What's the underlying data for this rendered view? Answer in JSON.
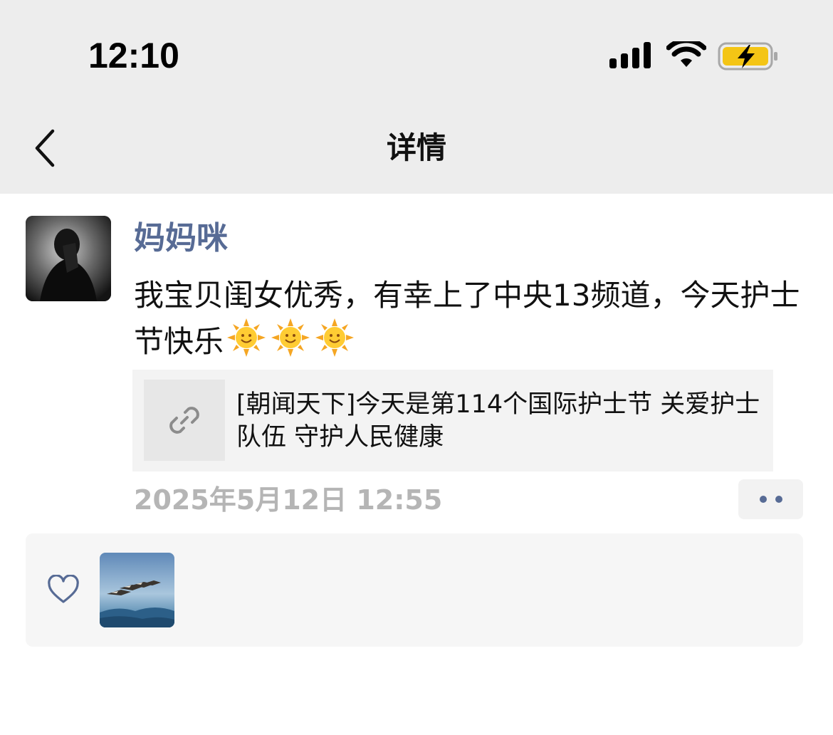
{
  "status_bar": {
    "time": "12:10",
    "icons": [
      "signal-icon",
      "wifi-icon",
      "battery-charging-icon"
    ],
    "battery_color": "#f4c515"
  },
  "nav": {
    "title": "详情",
    "back_icon": "chevron-left-icon"
  },
  "post": {
    "author": "妈妈咪",
    "text": "我宝贝闺女优秀，有幸上了中央13频道，今天护士节快乐",
    "emoji": [
      "sun-with-face",
      "sun-with-face",
      "sun-with-face"
    ],
    "link": {
      "icon": "link-icon",
      "title": "[朝闻天下]今天是第114个国际护士节 关爱护士队伍 守护人民健康"
    },
    "timestamp": "2025年5月12日 12:55",
    "more_icon": "more-dots-icon"
  },
  "likes": {
    "icon": "heart-outline-icon",
    "liker_count": 1
  },
  "colors": {
    "link_blue": "#576b95",
    "header_bg": "#ededed",
    "timestamp_grey": "#b5b5b5"
  }
}
